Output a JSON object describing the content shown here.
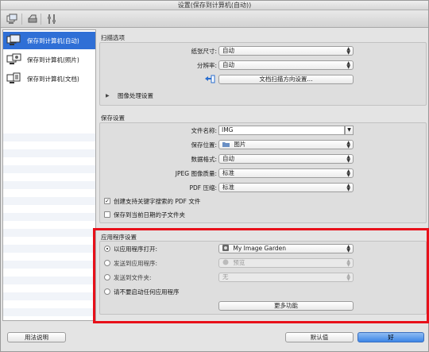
{
  "window": {
    "title": "设置(保存到计算机(自动))"
  },
  "toolbar": {
    "icons": [
      "scan-from-computer-icon",
      "scanner-icon",
      "general-settings-icon"
    ]
  },
  "sidebar": {
    "items": [
      {
        "label": "保存到计算机(自动)",
        "selected": true
      },
      {
        "label": "保存到计算机(照片)",
        "selected": false
      },
      {
        "label": "保存到计算机(文档)",
        "selected": false
      }
    ]
  },
  "scan_options": {
    "title": "扫描选项",
    "paper_size_label": "纸张尺寸:",
    "paper_size_value": "自动",
    "resolution_label": "分辨率:",
    "resolution_value": "自动",
    "orientation_button": "文档扫描方向设置...",
    "image_processing_label": "图像处理设置"
  },
  "save_settings": {
    "title": "保存设置",
    "file_name_label": "文件名称:",
    "file_name_value": "IMG",
    "save_location_label": "保存位置:",
    "save_location_value": "图片",
    "data_format_label": "数据格式:",
    "data_format_value": "自动",
    "jpeg_quality_label": "JPEG 图像质量:",
    "jpeg_quality_value": "标准",
    "pdf_compression_label": "PDF 压缩:",
    "pdf_compression_value": "标准",
    "create_searchable_pdf_label": "创建支持关键字搜索的 PDF 文件",
    "create_searchable_pdf_checked": true,
    "save_to_date_subfolder_label": "保存到当前日期的子文件夹",
    "save_to_date_subfolder_checked": false
  },
  "app_settings": {
    "title": "应用程序设置",
    "open_with_app_label": "以应用程序打开:",
    "open_with_app_value": "My Image Garden",
    "send_to_app_label": "发送到应用程序:",
    "send_to_app_value": "预览",
    "send_to_folder_label": "发送到文件夹:",
    "send_to_folder_value": "无",
    "do_not_start_label": "请不要启动任何应用程序",
    "more_functions_button": "更多功能",
    "selected_option": "open_with_app"
  },
  "footer": {
    "instructions_button": "用法说明",
    "defaults_button": "默认值",
    "ok_button": "好"
  },
  "colors": {
    "accent": "#2f6fd6",
    "highlight_box": "#e8101a"
  }
}
